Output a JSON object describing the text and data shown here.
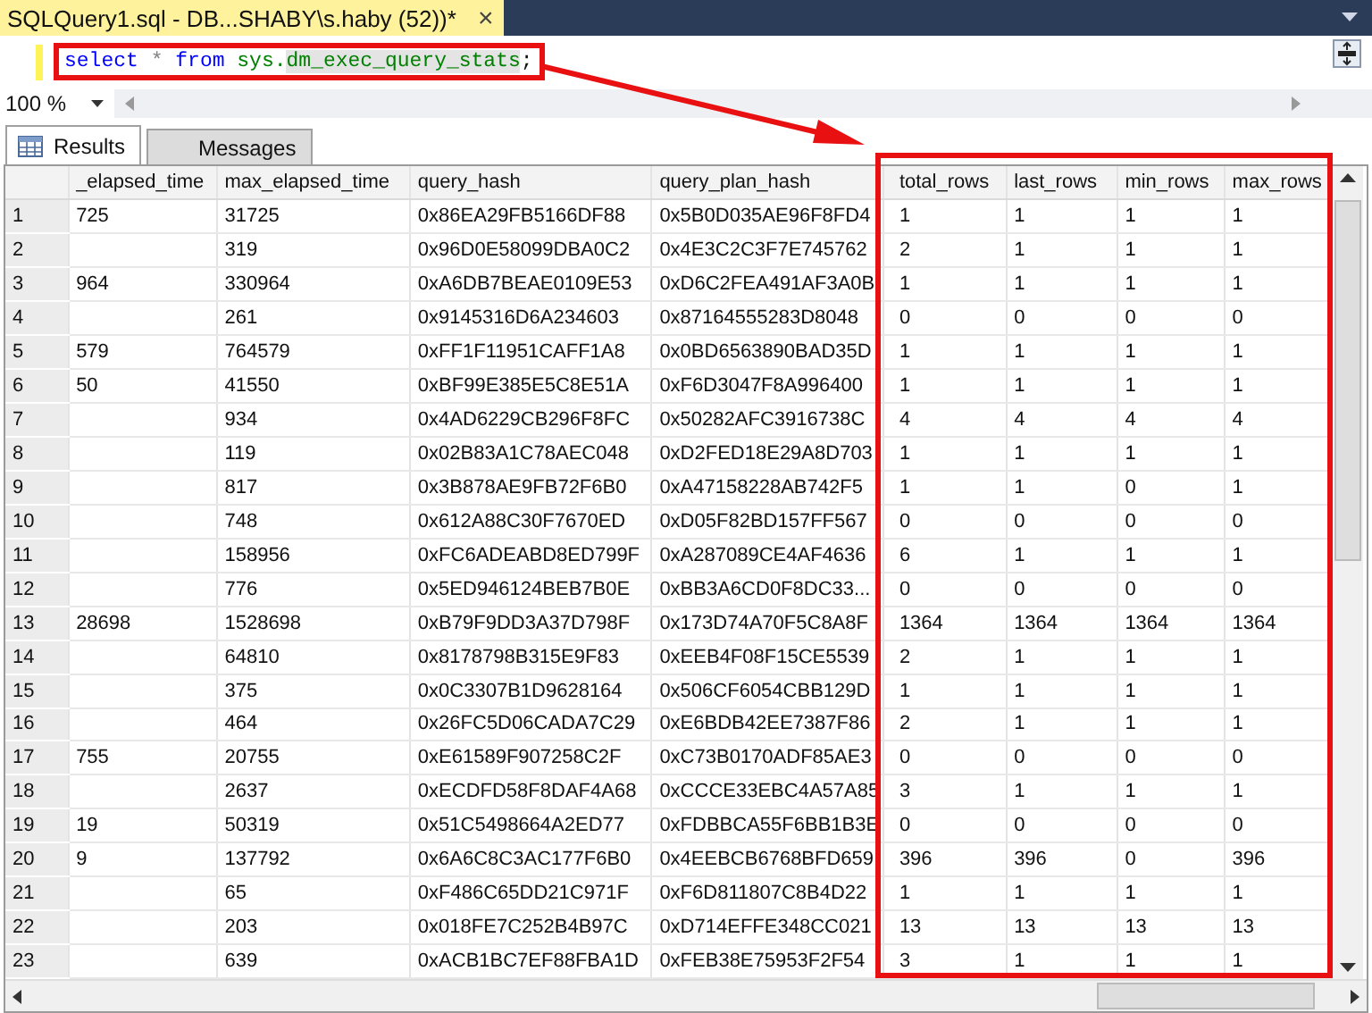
{
  "window": {
    "title": "SQLQuery1.sql - DB...SHABY\\s.haby (52))*",
    "close": "×"
  },
  "editor": {
    "tokens": [
      {
        "text": "select",
        "kind": "keyword"
      },
      {
        "text": "*",
        "kind": "operator"
      },
      {
        "text": "from",
        "kind": "keyword"
      },
      {
        "text": "sys.",
        "kind": "schema"
      },
      {
        "text": "dm_exec_query_stats",
        "kind": "object"
      },
      {
        "text": ";",
        "kind": "terminator"
      }
    ]
  },
  "zoom": {
    "value": "100 %"
  },
  "tabs": [
    {
      "label": "Results",
      "selected": true
    },
    {
      "label": "Messages",
      "selected": false
    }
  ],
  "table": {
    "columns": [
      "_elapsed_time",
      "max_elapsed_time",
      "query_hash",
      "query_plan_hash",
      "total_rows",
      "last_rows",
      "min_rows",
      "max_rows"
    ],
    "rows": [
      {
        "number": "1",
        "cells": [
          "725",
          "31725",
          "0x86EA29FB5166DF88",
          "0x5B0D035AE96F8FD4",
          "1",
          "1",
          "1",
          "1"
        ]
      },
      {
        "number": "2",
        "cells": [
          "",
          "319",
          "0x96D0E58099DBA0C2",
          "0x4E3C2C3F7E745762",
          "2",
          "1",
          "1",
          "1"
        ]
      },
      {
        "number": "3",
        "cells": [
          "964",
          "330964",
          "0xA6DB7BEAE0109E53",
          "0xD6C2FEA491AF3A0B",
          "1",
          "1",
          "1",
          "1"
        ]
      },
      {
        "number": "4",
        "cells": [
          "",
          "261",
          "0x9145316D6A234603",
          "0x87164555283D8048",
          "0",
          "0",
          "0",
          "0"
        ]
      },
      {
        "number": "5",
        "cells": [
          "579",
          "764579",
          "0xFF1F11951CAFF1A8",
          "0x0BD6563890BAD35D",
          "1",
          "1",
          "1",
          "1"
        ]
      },
      {
        "number": "6",
        "cells": [
          "50",
          "41550",
          "0xBF99E385E5C8E51A",
          "0xF6D3047F8A996400",
          "1",
          "1",
          "1",
          "1"
        ]
      },
      {
        "number": "7",
        "cells": [
          "",
          "934",
          "0x4AD6229CB296F8FC",
          "0x50282AFC3916738C",
          "4",
          "4",
          "4",
          "4"
        ]
      },
      {
        "number": "8",
        "cells": [
          "",
          "119",
          "0x02B83A1C78AEC048",
          "0xD2FED18E29A8D703",
          "1",
          "1",
          "1",
          "1"
        ]
      },
      {
        "number": "9",
        "cells": [
          "",
          "817",
          "0x3B878AE9FB72F6B0",
          "0xA47158228AB742F5",
          "1",
          "1",
          "0",
          "1"
        ]
      },
      {
        "number": "10",
        "cells": [
          "",
          "748",
          "0x612A88C30F7670ED",
          "0xD05F82BD157FF567",
          "0",
          "0",
          "0",
          "0"
        ]
      },
      {
        "number": "11",
        "cells": [
          "",
          "158956",
          "0xFC6ADEABD8ED799F",
          "0xA287089CE4AF4636",
          "6",
          "1",
          "1",
          "1"
        ]
      },
      {
        "number": "12",
        "cells": [
          "",
          "776",
          "0x5ED946124BEB7B0E",
          "0xBB3A6CD0F8DC33...",
          "0",
          "0",
          "0",
          "0"
        ]
      },
      {
        "number": "13",
        "cells": [
          "28698",
          "1528698",
          "0xB79F9DD3A37D798F",
          "0x173D74A70F5C8A8F",
          "1364",
          "1364",
          "1364",
          "1364"
        ]
      },
      {
        "number": "14",
        "cells": [
          "",
          "64810",
          "0x8178798B315E9F83",
          "0xEEB4F08F15CE5539",
          "2",
          "1",
          "1",
          "1"
        ]
      },
      {
        "number": "15",
        "cells": [
          "",
          "375",
          "0x0C3307B1D9628164",
          "0x506CF6054CBB129D",
          "1",
          "1",
          "1",
          "1"
        ]
      },
      {
        "number": "16",
        "cells": [
          "",
          "464",
          "0x26FC5D06CADA7C29",
          "0xE6BDB42EE7387F86",
          "2",
          "1",
          "1",
          "1"
        ]
      },
      {
        "number": "17",
        "cells": [
          "755",
          "20755",
          "0xE61589F907258C2F",
          "0xC73B0170ADF85AE3",
          "0",
          "0",
          "0",
          "0"
        ]
      },
      {
        "number": "18",
        "cells": [
          "",
          "2637",
          "0xECDFD58F8DAF4A68",
          "0xCCCE33EBC4A57A85",
          "3",
          "1",
          "1",
          "1"
        ]
      },
      {
        "number": "19",
        "cells": [
          "19",
          "50319",
          "0x51C5498664A2ED77",
          "0xFDBBCA55F6BB1B3E",
          "0",
          "0",
          "0",
          "0"
        ]
      },
      {
        "number": "20",
        "cells": [
          "9",
          "137792",
          "0x6A6C8C3AC177F6B0",
          "0x4EEBCB6768BFD659",
          "396",
          "396",
          "0",
          "396"
        ]
      },
      {
        "number": "21",
        "cells": [
          "",
          "65",
          "0xF486C65DD21C971F",
          "0xF6D811807C8B4D22",
          "1",
          "1",
          "1",
          "1"
        ]
      },
      {
        "number": "22",
        "cells": [
          "",
          "203",
          "0x018FE7C252B4B97C",
          "0xD714EFFE348CC021",
          "13",
          "13",
          "13",
          "13"
        ]
      },
      {
        "number": "23",
        "cells": [
          "",
          "639",
          "0xACB1BC7EF88FBA1D",
          "0xFEB38E75953F2F54",
          "3",
          "1",
          "1",
          "1"
        ]
      }
    ]
  }
}
